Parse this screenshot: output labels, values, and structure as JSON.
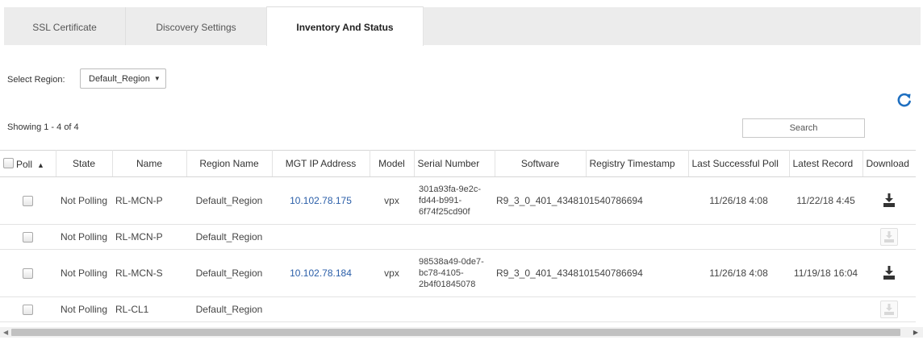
{
  "tabs": [
    {
      "label": "SSL Certificate",
      "active": false
    },
    {
      "label": "Discovery Settings",
      "active": false
    },
    {
      "label": "Inventory And Status",
      "active": true
    }
  ],
  "region": {
    "label": "Select Region:",
    "selected": "Default_Region"
  },
  "showing": "Showing 1 - 4 of 4",
  "search": {
    "placeholder": "Search",
    "value": ""
  },
  "table": {
    "columns": [
      "Poll",
      "State",
      "Name",
      "Region Name",
      "MGT IP Address",
      "Model",
      "Serial Number",
      "Software",
      "Registry Timestamp",
      "Last Successful Poll",
      "Latest Record",
      "Download"
    ],
    "rows": [
      {
        "state": "Not Polling",
        "name": "RL-MCN-P",
        "region": "Default_Region",
        "ip": "10.102.78.175",
        "model": "vpx",
        "serial": "301a93fa-9e2c-fd44-b991-6f74f25cd90f",
        "software": "R9_3_0_401_434810",
        "registry": "1540786694",
        "last_poll": "11/26/18 4:08",
        "latest_record": "11/22/18 4:45",
        "download_enabled": true
      },
      {
        "state": "Not Polling",
        "name": "RL-MCN-P",
        "region": "Default_Region",
        "ip": "",
        "model": "",
        "serial": "",
        "software": "",
        "registry": "",
        "last_poll": "",
        "latest_record": "",
        "download_enabled": false
      },
      {
        "state": "Not Polling",
        "name": "RL-MCN-S",
        "region": "Default_Region",
        "ip": "10.102.78.184",
        "model": "vpx",
        "serial": "98538a49-0de7-bc78-4105-2b4f01845078",
        "software": "R9_3_0_401_434810",
        "registry": "1540786694",
        "last_poll": "11/26/18 4:08",
        "latest_record": "11/19/18 16:04",
        "download_enabled": true
      },
      {
        "state": "Not Polling",
        "name": "RL-CL1",
        "region": "Default_Region",
        "ip": "",
        "model": "",
        "serial": "",
        "software": "",
        "registry": "",
        "last_poll": "",
        "latest_record": "",
        "download_enabled": false
      }
    ]
  },
  "icons": {
    "refresh": "refresh-icon",
    "download": "download-icon",
    "sort": "chevron-up-icon"
  },
  "colors": {
    "link": "#2a5ea8",
    "refresh": "#1e6fc0",
    "download_enabled": "#333333",
    "download_disabled": "#d8d8d8"
  }
}
